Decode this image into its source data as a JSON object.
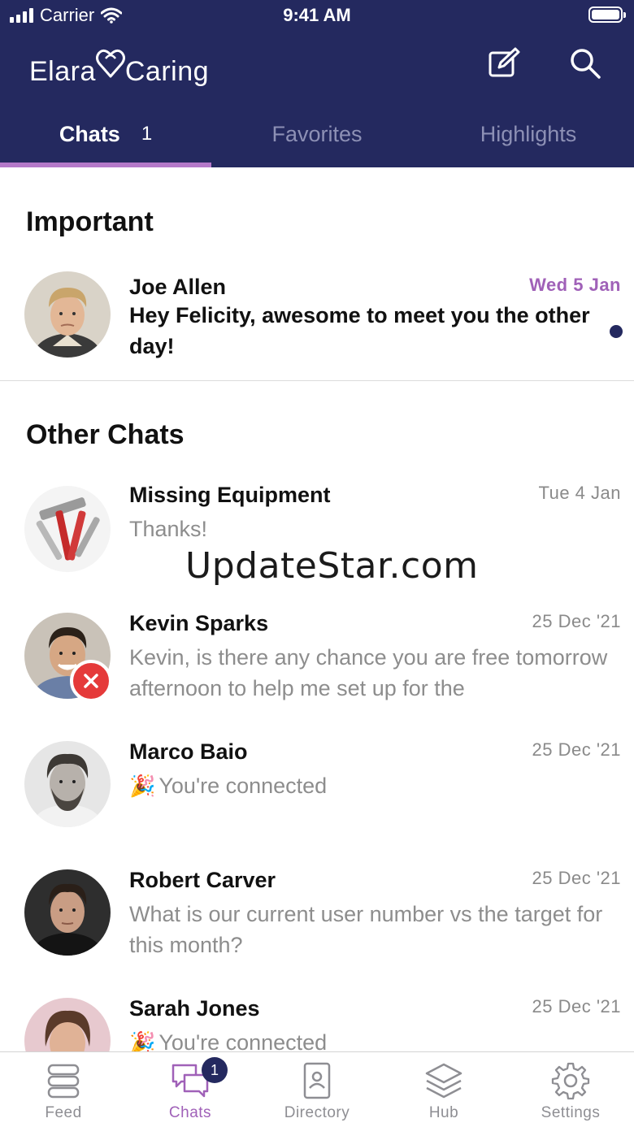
{
  "status_bar": {
    "carrier": "Carrier",
    "time": "9:41 AM"
  },
  "header": {
    "logo_text_left": "Elara",
    "logo_text_right": "Caring",
    "compose_icon": "compose-icon",
    "search_icon": "search-icon"
  },
  "tabs": [
    {
      "label": "Chats",
      "count": "1",
      "active": true
    },
    {
      "label": "Favorites",
      "active": false
    },
    {
      "label": "Highlights",
      "active": false
    }
  ],
  "sections": {
    "important_title": "Important",
    "other_title": "Other Chats"
  },
  "important_chats": [
    {
      "name": "Joe Allen",
      "time": "Wed 5 Jan",
      "message": "Hey Felicity, awesome to meet you the other day!",
      "unread": true
    }
  ],
  "other_chats": [
    {
      "name": "Missing Equipment",
      "time": "Tue 4 Jan",
      "message": "Thanks!"
    },
    {
      "name": "Kevin Sparks",
      "time": "25 Dec '21",
      "message": "Kevin, is there any chance you are free tomorrow afternoon to help me set up for the"
    },
    {
      "name": "Marco Baio",
      "time": "25 Dec '21",
      "message": "You're connected"
    },
    {
      "name": "Robert Carver",
      "time": "25 Dec '21",
      "message": "What is our current user number vs the target for this month?"
    },
    {
      "name": "Sarah Jones",
      "time": "25 Dec '21",
      "message": "You're connected"
    }
  ],
  "watermark": "UpdateStar.com",
  "bottom_nav": [
    {
      "label": "Feed",
      "icon": "feed-icon"
    },
    {
      "label": "Chats",
      "icon": "chats-icon",
      "badge": "1",
      "active": true
    },
    {
      "label": "Directory",
      "icon": "directory-icon"
    },
    {
      "label": "Hub",
      "icon": "hub-icon"
    },
    {
      "label": "Settings",
      "icon": "settings-icon"
    }
  ],
  "colors": {
    "header_bg": "#24295f",
    "accent": "#a061b8",
    "tab_underline": "#b479c9",
    "remove_badge": "#e53a3a"
  }
}
